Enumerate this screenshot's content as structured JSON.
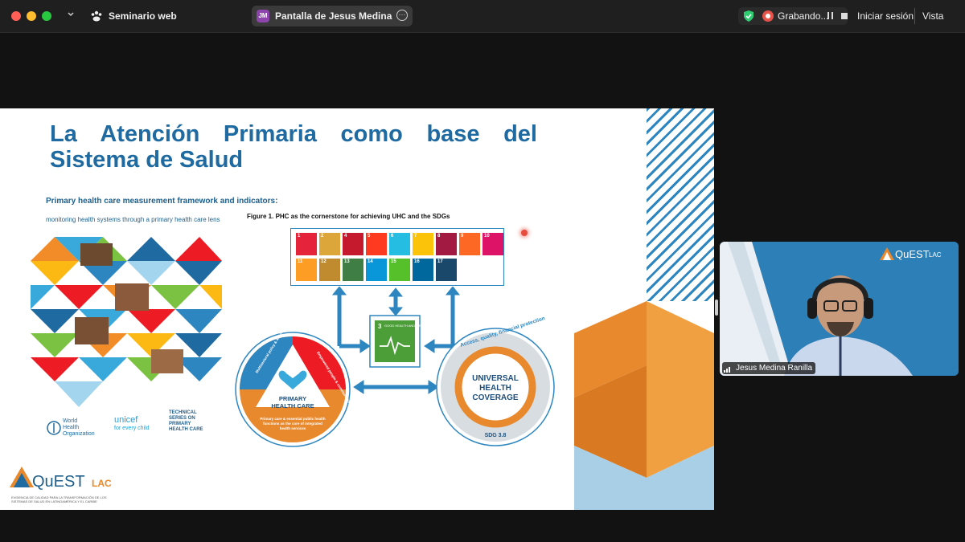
{
  "window": {
    "app_title": "Seminario web",
    "share_tab": {
      "initials": "JM",
      "label": "Pantalla de Jesus Medina Ranilla"
    },
    "recording_label": "Grabando...",
    "signin_label": "Iniciar sesión",
    "view_label": "Vista"
  },
  "slide": {
    "title": "La Atención Primaria como base del Sistema de Salud",
    "cover": {
      "title": "Primary health care measurement framework and indicators:",
      "subtitle": "monitoring health systems through a primary health care lens",
      "who": "World Health Organization",
      "unicef": "unicef",
      "unicef_sub": "for every child",
      "technical": "TECHNICAL SERIES ON PRIMARY HEALTH CARE"
    },
    "figure_caption": "Figure 1. PHC as the cornerstone for achieving UHC and the SDGs",
    "sdgs": [
      {
        "n": "1",
        "color": "#e5243b"
      },
      {
        "n": "2",
        "color": "#dda63a"
      },
      {
        "n": "4",
        "color": "#c5192d"
      },
      {
        "n": "5",
        "color": "#ff3a21"
      },
      {
        "n": "6",
        "color": "#26bde2"
      },
      {
        "n": "7",
        "color": "#fcc30b"
      },
      {
        "n": "8",
        "color": "#a21942"
      },
      {
        "n": "9",
        "color": "#fd6925"
      },
      {
        "n": "10",
        "color": "#dd1367"
      },
      {
        "n": "11",
        "color": "#fd9d24"
      },
      {
        "n": "12",
        "color": "#bf8b2e"
      },
      {
        "n": "13",
        "color": "#3f7e44"
      },
      {
        "n": "14",
        "color": "#0a97d9"
      },
      {
        "n": "15",
        "color": "#56c02b"
      },
      {
        "n": "16",
        "color": "#00689d"
      },
      {
        "n": "17",
        "color": "#19486a"
      }
    ],
    "sdg3": {
      "n": "3",
      "label": "GOOD HEALTH AND WELL-BEING",
      "color": "#4c9f38"
    },
    "phc": {
      "title_line1": "PRIMARY",
      "title_line2": "HEALTH CARE",
      "left": "Multisectoral policy & action",
      "right": "Empowered people & communities",
      "bottom_line1": "Primary care & essential public health",
      "bottom_line2": "functions as the core of integrated",
      "bottom_line3": "health services"
    },
    "uhc": {
      "arc": "Access, quality, financial protection",
      "line1": "UNIVERSAL",
      "line2": "HEALTH",
      "line3": "COVERAGE",
      "sdg": "SDG 3.8"
    },
    "quest": {
      "name": "QuEST",
      "suffix": "LAC",
      "tagline": "EVIDENCIA DE CALIDAD PARA LA TRANSFORMACIÓN DE LOS SISTEMAS DE SALUD EN LATINOAMÉRICA Y EL CARIBE"
    }
  },
  "participant": {
    "name": "Jesus Medina Ranilla",
    "logo_name": "QuEST",
    "logo_suffix": "LAC"
  },
  "colors": {
    "accent_blue": "#1f6aa0",
    "orange": "#e8892e",
    "red": "#e5534b"
  }
}
